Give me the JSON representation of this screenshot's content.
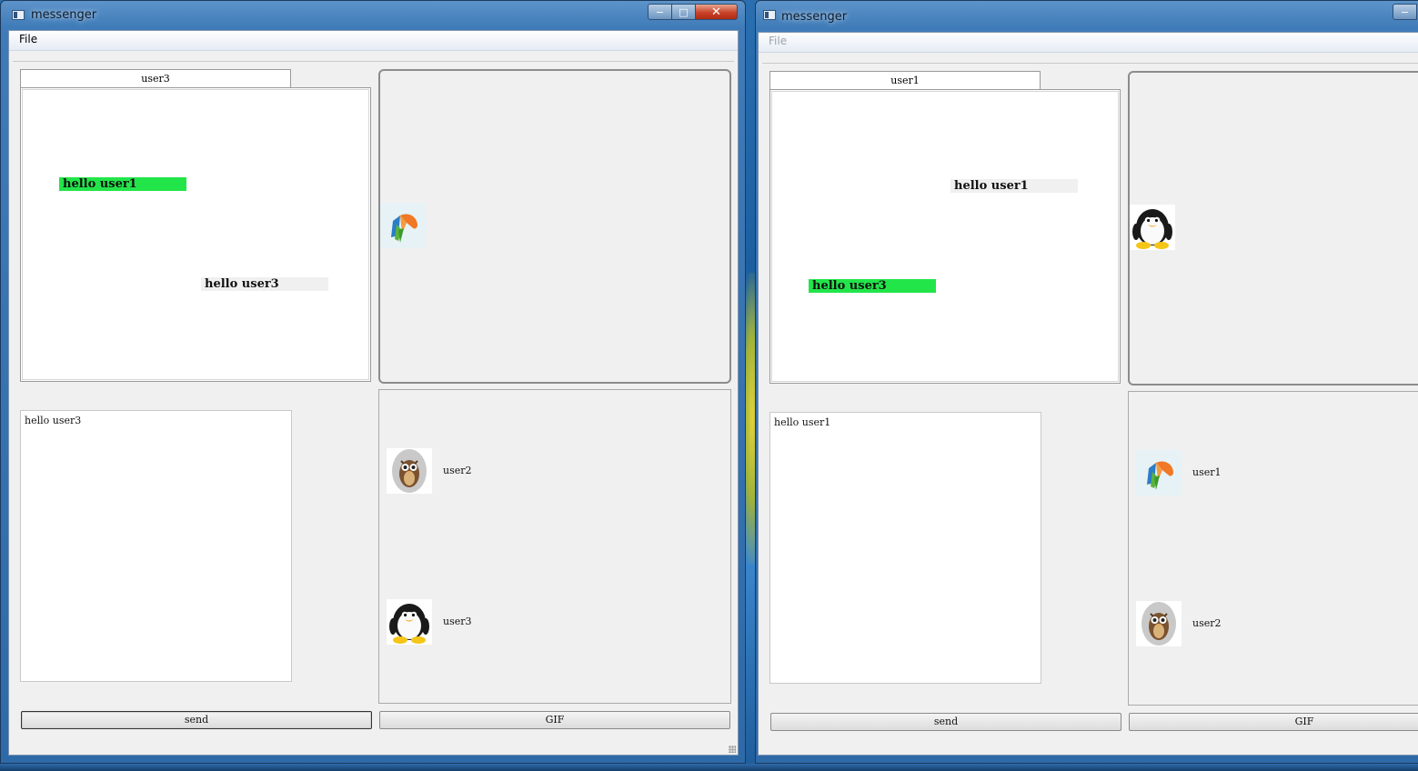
{
  "windows": [
    {
      "title": "messenger",
      "caption": {
        "minimize": "−",
        "maximize": "□",
        "close": "✕"
      },
      "menu": {
        "file": "File"
      },
      "chat_tab": {
        "label": "user3"
      },
      "messages": [
        {
          "text": "hello user1",
          "style": "green"
        },
        {
          "text": "hello user3",
          "style": "gray"
        }
      ],
      "gif_avatar": "parrot-icon",
      "input": {
        "value": "hello user3"
      },
      "users": [
        {
          "name": "user2",
          "avatar": "owl-icon"
        },
        {
          "name": "user3",
          "avatar": "penguin-icon"
        }
      ],
      "buttons": {
        "send": "send",
        "gif": "GIF"
      }
    },
    {
      "title": "messenger",
      "caption": {
        "minimize": "−"
      },
      "menu": {
        "file": "File"
      },
      "chat_tab": {
        "label": "user1"
      },
      "messages": [
        {
          "text": "hello user1",
          "style": "gray"
        },
        {
          "text": "hello user3",
          "style": "green"
        }
      ],
      "gif_avatar": "penguin-icon",
      "input": {
        "value": "hello user1"
      },
      "users": [
        {
          "name": "user1",
          "avatar": "parrot-icon"
        },
        {
          "name": "user2",
          "avatar": "owl-icon"
        }
      ],
      "buttons": {
        "send": "send",
        "gif": "GIF"
      }
    }
  ],
  "colors": {
    "message_highlight": "#22e54a",
    "panel_bg": "#f0f0f0",
    "title_gradient": "#3f7bb8"
  }
}
